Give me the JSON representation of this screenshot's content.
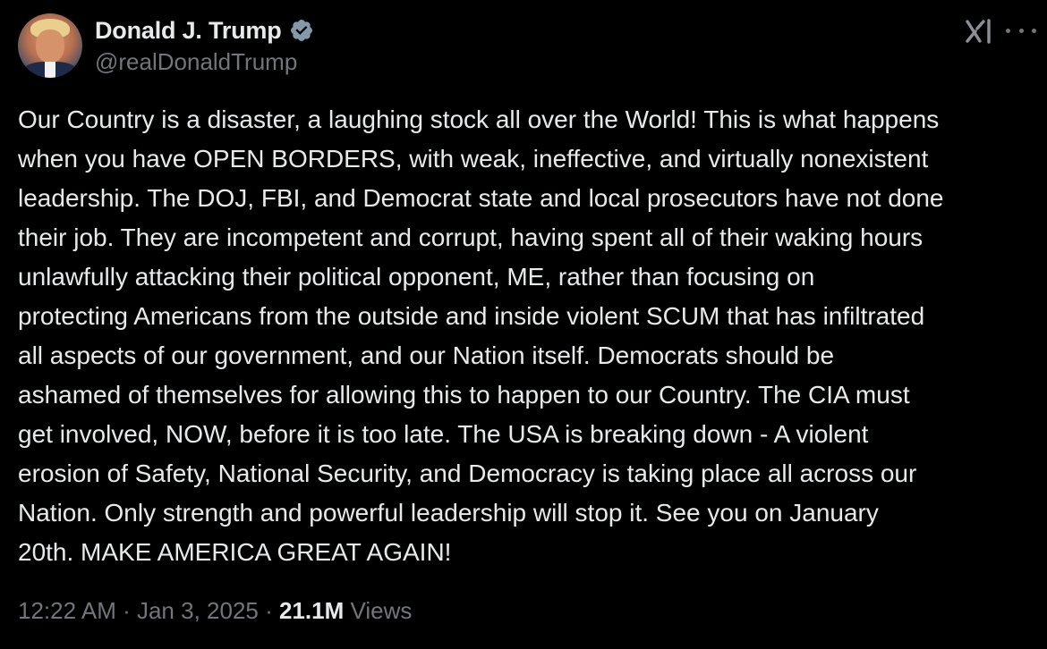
{
  "author": {
    "display_name": "Donald J. Trump",
    "handle": "@realDonaldTrump",
    "verified": true,
    "verified_color": "#829aab"
  },
  "post": {
    "lines": [
      "Our Country is a disaster, a laughing stock all over the World! This is what happens",
      "when you have OPEN BORDERS, with weak, ineffective, and virtually nonexistent",
      "leadership. The DOJ, FBI, and Democrat state and local prosecutors have not done",
      "their job. They are incompetent and corrupt, having spent all of their waking hours",
      "unlawfully attacking their political opponent, ME, rather than focusing on",
      "protecting Americans from the outside and inside violent SCUM that has infiltrated",
      "all aspects of our government, and our Nation itself. Democrats should be",
      "ashamed of themselves for allowing this to happen to our Country. The CIA must",
      "get involved, NOW, before it is too late. The USA is breaking down - A violent",
      "erosion of Safety, National Security, and Democracy is taking place all across our",
      "Nation. Only strength and powerful leadership will stop it. See you on January",
      "20th. MAKE AMERICA GREAT AGAIN!"
    ]
  },
  "meta": {
    "time": "12:22 AM",
    "separator": " · ",
    "date": "Jan 3, 2025",
    "views_count": "21.1M",
    "views_label": " Views"
  },
  "icons": {
    "grok": "grok-icon",
    "more": "more-icon",
    "verified": "verified-badge-icon"
  },
  "colors": {
    "background": "#000000",
    "primary_text": "#e7e9ea",
    "secondary_text": "#71767b"
  }
}
